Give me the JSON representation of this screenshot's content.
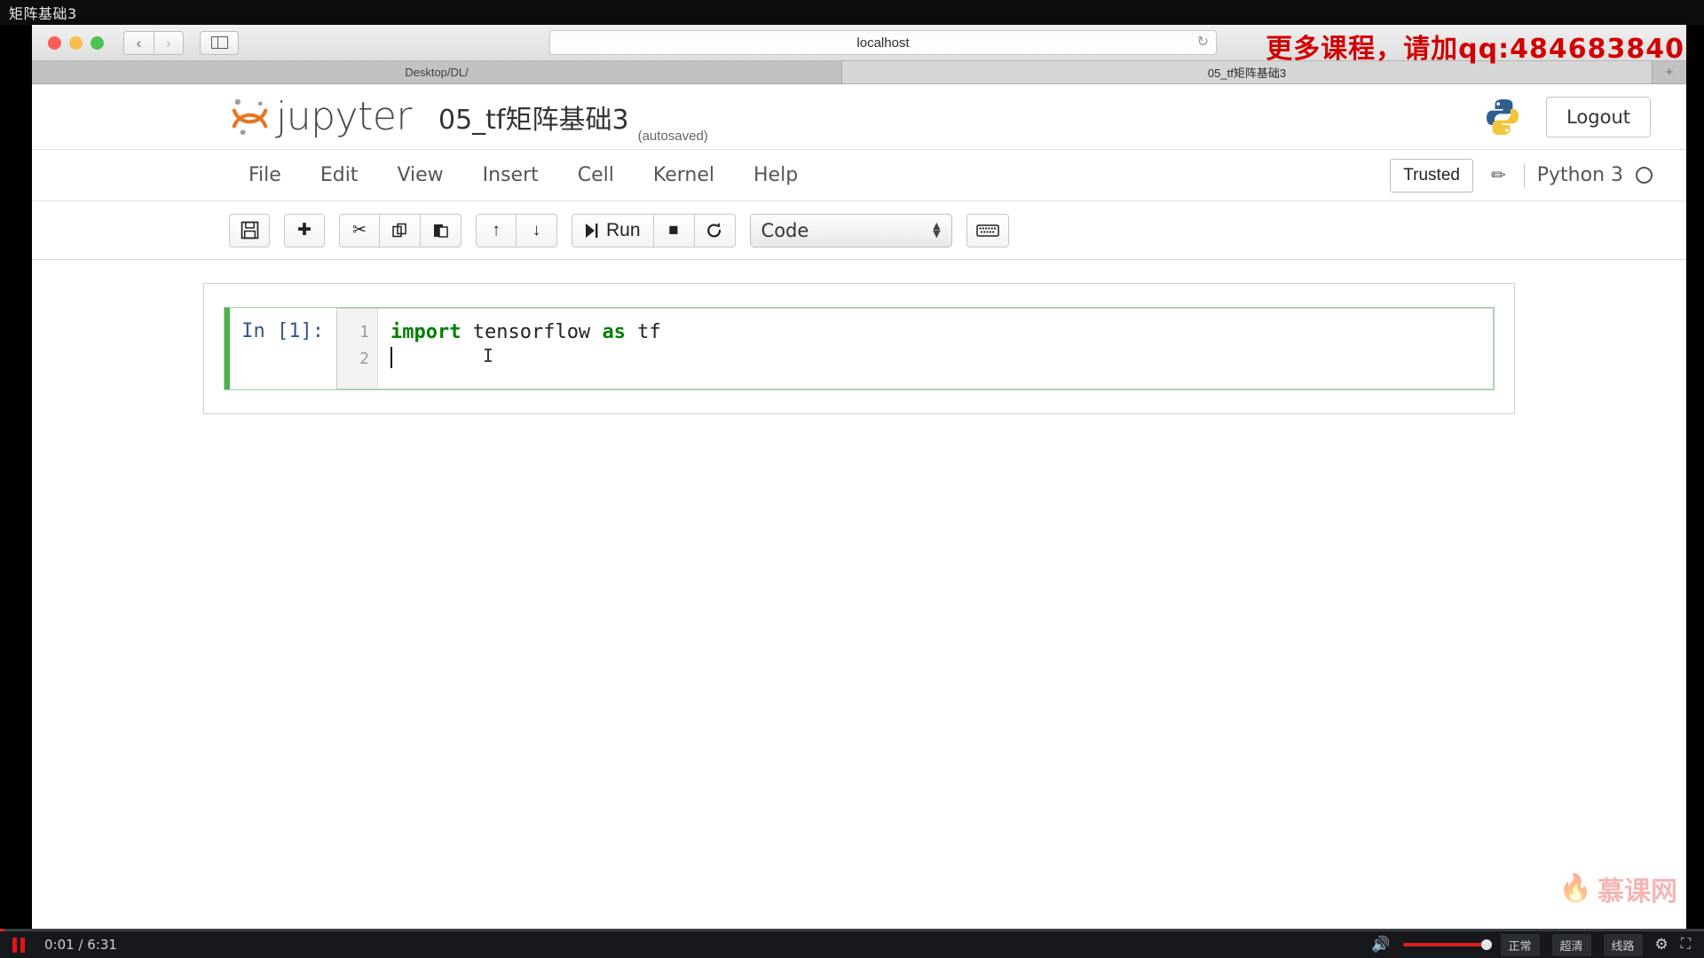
{
  "player": {
    "video_title": "矩阵基础3",
    "current_time": "0:01",
    "total_time": "6:31",
    "time_display": "0:01 / 6:31",
    "pause_label": "pause",
    "quality_options": [
      "正常",
      "超清",
      "线路"
    ],
    "accent_color": "#e02020"
  },
  "browser": {
    "url": "localhost",
    "reload_glyph": "↻",
    "back_glyph": "‹",
    "forward_glyph": "›",
    "tabs": [
      {
        "label": "Desktop/DL/",
        "active": false
      },
      {
        "label": "05_tf矩阵基础3",
        "active": true
      }
    ],
    "new_tab_glyph": "+"
  },
  "jupyter": {
    "brand": "jupyter",
    "notebook_name": "05_tf矩阵基础3",
    "autosaved_label": "(autosaved)",
    "logout_label": "Logout",
    "menus": [
      "File",
      "Edit",
      "View",
      "Insert",
      "Cell",
      "Kernel",
      "Help"
    ],
    "trusted_label": "Trusted",
    "pencil_glyph": "✏",
    "kernel_label": "Python 3",
    "toolbar": {
      "save_glyph": "💾",
      "insert_glyph": "✚",
      "cut_glyph": "✂",
      "copy_glyph": "⧉",
      "paste_glyph": "📋",
      "move_up_glyph": "↑",
      "move_down_glyph": "↓",
      "run_glyph": "▶|",
      "run_label": "Run",
      "stop_glyph": "■",
      "restart_glyph": "↻",
      "cell_type": "Code",
      "keyboard_glyph": "⌨"
    },
    "cell": {
      "prompt": "In [1]:",
      "line_numbers": [
        "1",
        "2"
      ],
      "code_line1_kw1": "import",
      "code_line1_mid": " tensorflow ",
      "code_line1_kw2": "as",
      "code_line1_end": " tf",
      "code_line2": ""
    }
  },
  "overlay": {
    "ad_text": "更多课程，请加qq:484683840",
    "ad_color": "#d10000",
    "brand_text": "慕课网",
    "brand_flame": "🔥"
  }
}
